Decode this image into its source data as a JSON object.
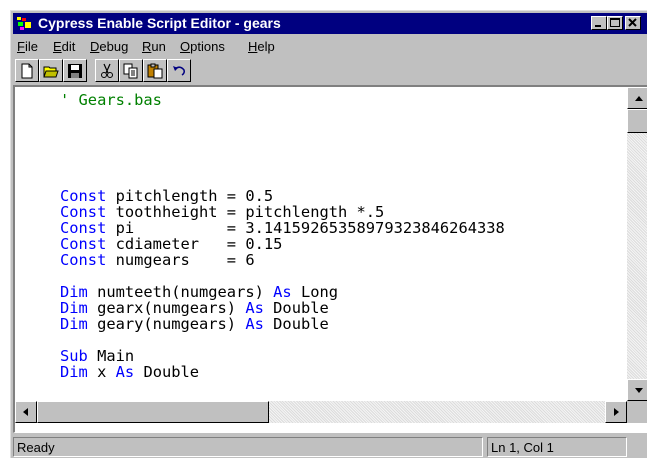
{
  "window": {
    "title": "Cypress Enable Script Editor - gears",
    "minimize_icon": "minimize-icon",
    "maximize_icon": "maximize-icon",
    "close_icon": "close-icon"
  },
  "menu": {
    "items": [
      {
        "label": "File",
        "accel": "F",
        "rest": "ile"
      },
      {
        "label": "Edit",
        "accel": "E",
        "rest": "dit"
      },
      {
        "label": "Debug",
        "accel": "D",
        "rest": "ebug"
      },
      {
        "label": "Run",
        "accel": "R",
        "rest": "un"
      },
      {
        "label": "Options",
        "accel": "O",
        "rest": "ptions"
      },
      {
        "label": "Help",
        "accel": "H",
        "rest": "elp"
      }
    ]
  },
  "toolbar": {
    "icons": [
      "new-file-icon",
      "open-folder-icon",
      "save-icon",
      "cut-icon",
      "copy-icon",
      "paste-icon",
      "undo-icon"
    ]
  },
  "code": {
    "line01": "' Gears.bas",
    "line05_kw": "Const",
    "line05_rest": " pitchlength = 0.5",
    "line06_kw": "Const",
    "line06_rest": " toothheight = pitchlength *.5",
    "line07_kw": "Const",
    "line07_rest": " pi          = 3.14159265358979323846264338",
    "line08_kw": "Const",
    "line08_rest": " cdiameter   = 0.15",
    "line09_kw": "Const",
    "line09_rest": " numgears    = 6",
    "line11_kw": "Dim",
    "line11_mid": " numteeth(numgears) ",
    "line11_as": "As",
    "line11_type": " Long",
    "line12_kw": "Dim",
    "line12_mid": " gearx(numgears) ",
    "line12_as": "As",
    "line12_type": " Double",
    "line13_kw": "Dim",
    "line13_mid": " geary(numgears) ",
    "line13_as": "As",
    "line13_type": " Double",
    "line15_kw": "Sub",
    "line15_rest": " Main",
    "line16_kw": "Dim",
    "line16_mid": " x ",
    "line16_as": "As",
    "line16_type": " Double"
  },
  "status": {
    "message": "Ready",
    "position": "Ln 1, Col 1"
  },
  "colors": {
    "titlebar": "#000080",
    "keyword": "#0000ff",
    "comment": "#008000"
  }
}
